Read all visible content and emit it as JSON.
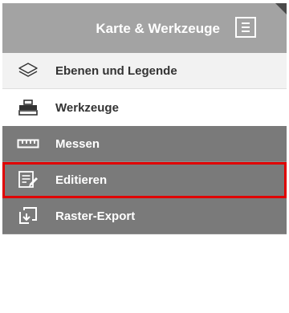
{
  "header": {
    "title": "Karte & Werkzeuge",
    "menu_icon": "hamburger-menu-icon"
  },
  "menu": {
    "items": [
      {
        "label": "Ebenen und Legende",
        "icon": "layers-icon",
        "style": "light"
      },
      {
        "label": "Werkzeuge",
        "icon": "toolbox-icon",
        "style": "white"
      },
      {
        "label": "Messen",
        "icon": "ruler-icon",
        "style": "dark"
      },
      {
        "label": "Editieren",
        "icon": "edit-document-icon",
        "style": "dark",
        "selected": true
      },
      {
        "label": "Raster-Export",
        "icon": "raster-export-icon",
        "style": "dark"
      }
    ]
  },
  "colors": {
    "header_bg": "#a3a3a3",
    "dark_item_bg": "#7a7a7a",
    "selection_outline": "#e00000"
  }
}
